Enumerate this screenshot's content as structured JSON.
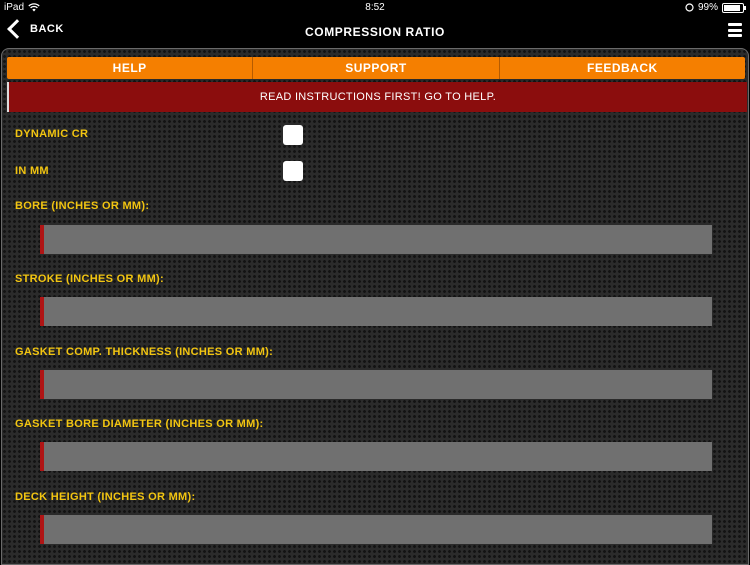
{
  "status": {
    "device": "iPad",
    "time": "8:52",
    "battery": "99%"
  },
  "nav": {
    "back_label": "BACK",
    "title": "COMPRESSION RATIO"
  },
  "tabs": [
    "HELP",
    "SUPPORT",
    "FEEDBACK"
  ],
  "alert_text": "READ INSTRUCTIONS FIRST! GO TO HELP.",
  "options": {
    "dynamic_cr": "DYNAMIC CR",
    "in_mm": "IN MM"
  },
  "fields": [
    {
      "label": "BORE (INCHES OR MM):",
      "value": ""
    },
    {
      "label": "STROKE (INCHES OR MM):",
      "value": ""
    },
    {
      "label": "GASKET COMP. THICKNESS (INCHES OR MM):",
      "value": ""
    },
    {
      "label": "GASKET BORE DIAMETER (INCHES OR MM):",
      "value": ""
    },
    {
      "label": "DECK HEIGHT (INCHES OR MM):",
      "value": ""
    }
  ],
  "colors": {
    "accent_orange": "#f57f00",
    "alert_red": "#8b0d0d",
    "label_yellow": "#f2c511",
    "field_gray": "#707070"
  }
}
